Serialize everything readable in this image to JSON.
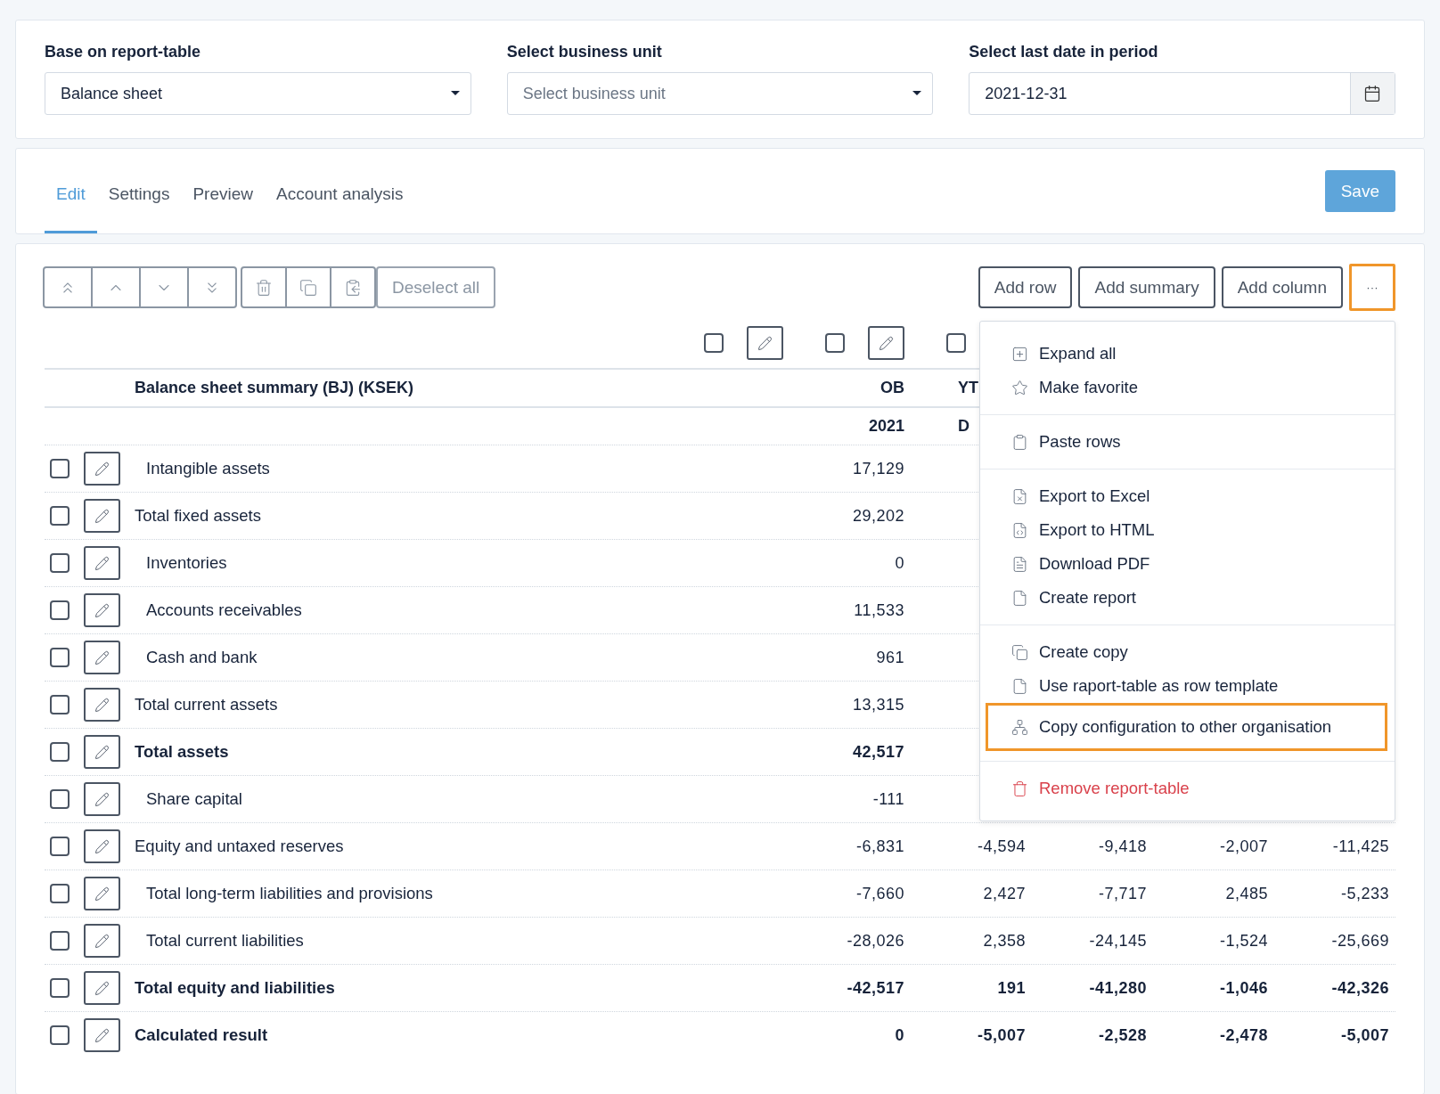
{
  "filters": [
    {
      "kind": "select",
      "label": "Base on report-table",
      "value": "Balance sheet"
    },
    {
      "kind": "select",
      "label": "Select business unit",
      "placeholder": "Select business unit"
    },
    {
      "kind": "date",
      "label": "Select last date in period",
      "value": "2021-12-31"
    }
  ],
  "tabs": [
    {
      "label": "Edit",
      "selected": true
    },
    {
      "label": "Settings",
      "selected": false
    },
    {
      "label": "Preview",
      "selected": false
    },
    {
      "label": "Account analysis",
      "selected": false
    }
  ],
  "save_button": "Save",
  "toolbar": {
    "deselect": {
      "label": "Deselect all",
      "disabled": true
    },
    "actions": [
      {
        "label": "Add row"
      },
      {
        "label": "Add summary"
      },
      {
        "label": "Add column"
      }
    ],
    "more": {
      "label": "···",
      "focused": true
    }
  },
  "column_controls": [
    {
      "checked": false
    },
    {
      "checked": false
    },
    {
      "checked": false
    }
  ],
  "table": {
    "title": "Balance sheet summary (BJ) (KSEK)",
    "columns": [
      {
        "heading": "OB",
        "subheading": "2021"
      },
      {
        "heading": "YT",
        "subheading": "D"
      }
    ],
    "rows": [
      {
        "label": "Intangible assets",
        "kind": "line",
        "checked": false,
        "values": [
          "17,129"
        ]
      },
      {
        "label": "Total fixed assets",
        "kind": "subtotal",
        "checked": false,
        "values": [
          "29,202"
        ]
      },
      {
        "label": "Inventories",
        "kind": "line",
        "checked": false,
        "values": [
          "0"
        ]
      },
      {
        "label": "Accounts receivables",
        "kind": "line",
        "checked": false,
        "values": [
          "11,533"
        ]
      },
      {
        "label": "Cash and bank",
        "kind": "line",
        "checked": false,
        "values": [
          "961"
        ]
      },
      {
        "label": "Total current assets",
        "kind": "subtotal",
        "checked": false,
        "values": [
          "13,315"
        ]
      },
      {
        "label": "Total assets",
        "kind": "total",
        "checked": false,
        "values": [
          "42,517"
        ]
      },
      {
        "label": "Share capital",
        "kind": "line",
        "checked": false,
        "values": [
          "-111"
        ]
      },
      {
        "label": "Equity and untaxed reserves",
        "kind": "subtotal",
        "checked": false,
        "values": [
          "-6,831",
          "-4,594",
          "-9,418",
          "-2,007",
          "-11,425"
        ]
      },
      {
        "label": "Total long-term liabilities and provisions",
        "kind": "line",
        "checked": false,
        "values": [
          "-7,660",
          "2,427",
          "-7,717",
          "2,485",
          "-5,233"
        ]
      },
      {
        "label": "Total current liabilities",
        "kind": "line",
        "checked": false,
        "values": [
          "-28,026",
          "2,358",
          "-24,145",
          "-1,524",
          "-25,669"
        ]
      },
      {
        "label": "Total equity and liabilities",
        "kind": "total",
        "checked": false,
        "values": [
          "-42,517",
          "191",
          "-41,280",
          "-1,046",
          "-42,326"
        ]
      },
      {
        "label": "Calculated result",
        "kind": "total",
        "checked": false,
        "values": [
          "0",
          "-5,007",
          "-2,528",
          "-2,478",
          "-5,007"
        ]
      }
    ]
  },
  "menu": {
    "groups": [
      [
        {
          "label": "Expand all",
          "kind": "normal",
          "highlighted": false
        },
        {
          "label": "Make favorite",
          "kind": "normal",
          "highlighted": false
        }
      ],
      [
        {
          "label": "Paste rows",
          "kind": "normal",
          "highlighted": false
        }
      ],
      [
        {
          "label": "Export to Excel",
          "kind": "normal",
          "highlighted": false
        },
        {
          "label": "Export to HTML",
          "kind": "normal",
          "highlighted": false
        },
        {
          "label": "Download PDF",
          "kind": "normal",
          "highlighted": false
        },
        {
          "label": "Create report",
          "kind": "normal",
          "highlighted": false
        }
      ],
      [
        {
          "label": "Create copy",
          "kind": "normal",
          "highlighted": false
        },
        {
          "label": "Use raport-table as row template",
          "kind": "normal",
          "highlighted": false
        },
        {
          "label": "Copy configuration to other organisation",
          "kind": "normal",
          "highlighted": true
        }
      ],
      [
        {
          "label": "Remove report-table",
          "kind": "danger",
          "highlighted": false
        }
      ]
    ]
  }
}
